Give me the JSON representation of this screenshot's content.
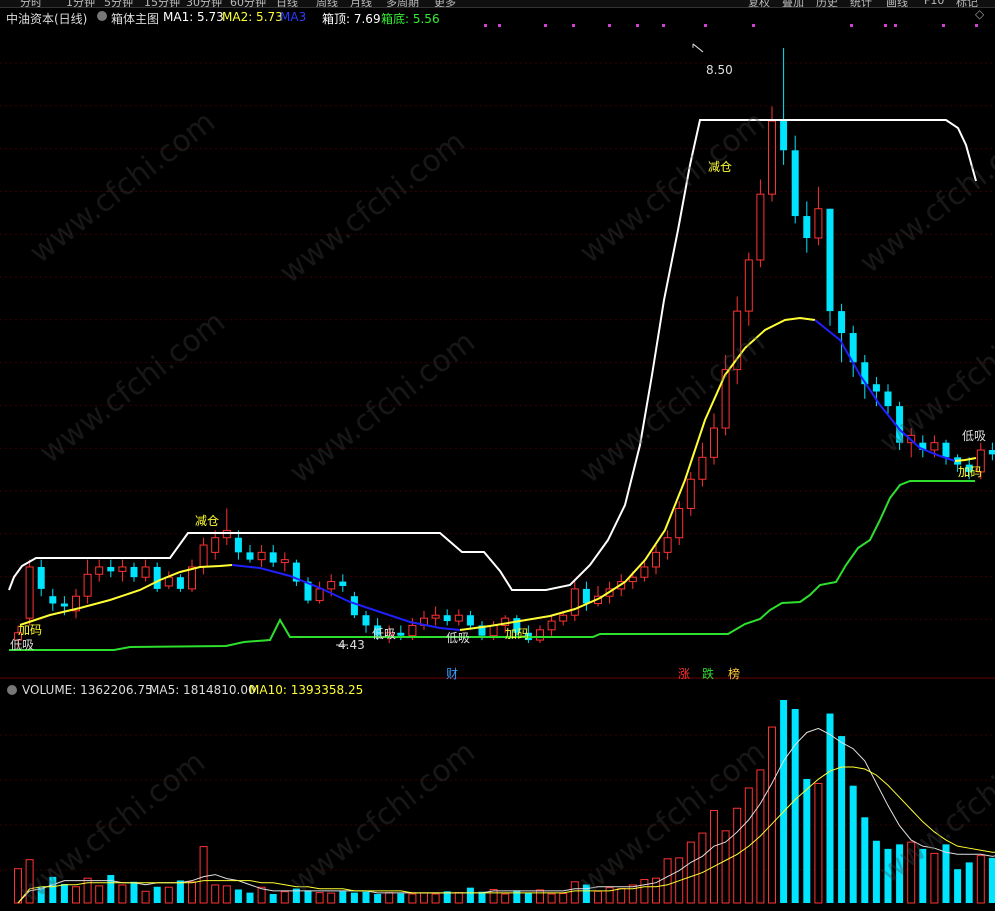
{
  "toolbar": {
    "periods": [
      "分时",
      "1分钟",
      "5分钟",
      "15分钟",
      "30分钟",
      "60分钟",
      "日线",
      "周线",
      "月线",
      "多周期",
      "更多"
    ],
    "right_buttons": [
      "复权",
      "叠加",
      "历史",
      "统计",
      "画线",
      "F10",
      "标记"
    ]
  },
  "main_panel": {
    "stock_name": "中油资本(日线)",
    "indicator_name": "箱体主图",
    "ma1_label": "MA1: 5.73",
    "ma2_label": "MA2: 5.73",
    "ma3_label": "MA3",
    "box_top_label": "箱顶: 7.69",
    "box_bottom_label": "箱底: 5.56"
  },
  "annotations": {
    "high_price": "8.50",
    "low_price": "4.43",
    "reduce1": "减仓",
    "reduce2": "减仓",
    "buy_low1": "低吸",
    "buy_low2": "低吸",
    "buy_low3": "低吸",
    "buy_low4": "低吸",
    "add1": "加码",
    "add2": "加码",
    "add3": "加码"
  },
  "event_markers": {
    "cai": "财",
    "zhang": "涨",
    "die": "跌",
    "bang": "榜"
  },
  "volume_panel": {
    "volume_label": "VOLUME: 1362206.75",
    "ma5_label": "MA5: 1814810.00",
    "ma10_label": "MA10: 1393358.25"
  },
  "watermark": "www.cfchi.com",
  "colors": {
    "up": "#ff3232",
    "down": "#00e5ff",
    "box_top": "#ffffff",
    "box_bottom": "#2ee02e",
    "ma_rise": "#ffff33",
    "ma_fall": "#2020ff",
    "cai": "#3aa0ff",
    "zhang": "#ff3030",
    "die": "#33dd33",
    "bang": "#ffcc33"
  },
  "chart_data": {
    "type": "candlestick",
    "price_range": [
      4.3,
      8.65
    ],
    "candles": [
      {
        "o": 4.45,
        "c": 4.5,
        "h": 4.55,
        "l": 4.4
      },
      {
        "o": 4.6,
        "c": 4.95,
        "h": 5.0,
        "l": 4.55
      },
      {
        "o": 4.95,
        "c": 4.8,
        "h": 5.0,
        "l": 4.75
      },
      {
        "o": 4.75,
        "c": 4.7,
        "h": 4.8,
        "l": 4.65
      },
      {
        "o": 4.7,
        "c": 4.68,
        "h": 4.75,
        "l": 4.62
      },
      {
        "o": 4.65,
        "c": 4.75,
        "h": 4.8,
        "l": 4.6
      },
      {
        "o": 4.75,
        "c": 4.9,
        "h": 5.0,
        "l": 4.7
      },
      {
        "o": 4.9,
        "c": 4.95,
        "h": 5.0,
        "l": 4.85
      },
      {
        "o": 4.95,
        "c": 4.92,
        "h": 5.0,
        "l": 4.88
      },
      {
        "o": 4.92,
        "c": 4.95,
        "h": 5.0,
        "l": 4.85
      },
      {
        "o": 4.95,
        "c": 4.88,
        "h": 4.98,
        "l": 4.85
      },
      {
        "o": 4.88,
        "c": 4.95,
        "h": 5.0,
        "l": 4.85
      },
      {
        "o": 4.95,
        "c": 4.8,
        "h": 4.98,
        "l": 4.78
      },
      {
        "o": 4.82,
        "c": 4.88,
        "h": 4.92,
        "l": 4.8
      },
      {
        "o": 4.88,
        "c": 4.8,
        "h": 4.9,
        "l": 4.78
      },
      {
        "o": 4.8,
        "c": 4.95,
        "h": 5.0,
        "l": 4.78
      },
      {
        "o": 4.95,
        "c": 5.1,
        "h": 5.15,
        "l": 4.9
      },
      {
        "o": 5.05,
        "c": 5.15,
        "h": 5.2,
        "l": 5.0
      },
      {
        "o": 5.15,
        "c": 5.2,
        "h": 5.35,
        "l": 5.1
      },
      {
        "o": 5.15,
        "c": 5.05,
        "h": 5.2,
        "l": 5.0
      },
      {
        "o": 5.05,
        "c": 5.0,
        "h": 5.1,
        "l": 4.98
      },
      {
        "o": 5.0,
        "c": 5.05,
        "h": 5.1,
        "l": 4.95
      },
      {
        "o": 5.05,
        "c": 4.98,
        "h": 5.1,
        "l": 4.95
      },
      {
        "o": 4.98,
        "c": 5.0,
        "h": 5.05,
        "l": 4.92
      },
      {
        "o": 4.98,
        "c": 4.85,
        "h": 5.0,
        "l": 4.82
      },
      {
        "o": 4.85,
        "c": 4.72,
        "h": 4.88,
        "l": 4.7
      },
      {
        "o": 4.72,
        "c": 4.8,
        "h": 4.85,
        "l": 4.7
      },
      {
        "o": 4.8,
        "c": 4.85,
        "h": 4.9,
        "l": 4.75
      },
      {
        "o": 4.85,
        "c": 4.82,
        "h": 4.9,
        "l": 4.78
      },
      {
        "o": 4.75,
        "c": 4.62,
        "h": 4.78,
        "l": 4.6
      },
      {
        "o": 4.62,
        "c": 4.55,
        "h": 4.65,
        "l": 4.5
      },
      {
        "o": 4.55,
        "c": 4.48,
        "h": 4.6,
        "l": 4.45
      },
      {
        "o": 4.48,
        "c": 4.5,
        "h": 4.55,
        "l": 4.43
      },
      {
        "o": 4.5,
        "c": 4.48,
        "h": 4.55,
        "l": 4.45
      },
      {
        "o": 4.48,
        "c": 4.55,
        "h": 4.6,
        "l": 4.45
      },
      {
        "o": 4.55,
        "c": 4.6,
        "h": 4.65,
        "l": 4.52
      },
      {
        "o": 4.6,
        "c": 4.62,
        "h": 4.68,
        "l": 4.55
      },
      {
        "o": 4.62,
        "c": 4.58,
        "h": 4.66,
        "l": 4.55
      },
      {
        "o": 4.58,
        "c": 4.62,
        "h": 4.66,
        "l": 4.55
      },
      {
        "o": 4.62,
        "c": 4.55,
        "h": 4.65,
        "l": 4.52
      },
      {
        "o": 4.55,
        "c": 4.48,
        "h": 4.58,
        "l": 4.45
      },
      {
        "o": 4.48,
        "c": 4.55,
        "h": 4.58,
        "l": 4.45
      },
      {
        "o": 4.55,
        "c": 4.6,
        "h": 4.62,
        "l": 4.5
      },
      {
        "o": 4.6,
        "c": 4.5,
        "h": 4.62,
        "l": 4.48
      },
      {
        "o": 4.5,
        "c": 4.45,
        "h": 4.55,
        "l": 4.43
      },
      {
        "o": 4.45,
        "c": 4.52,
        "h": 4.55,
        "l": 4.43
      },
      {
        "o": 4.52,
        "c": 4.58,
        "h": 4.62,
        "l": 4.48
      },
      {
        "o": 4.58,
        "c": 4.62,
        "h": 4.65,
        "l": 4.55
      },
      {
        "o": 4.62,
        "c": 4.8,
        "h": 4.85,
        "l": 4.58
      },
      {
        "o": 4.8,
        "c": 4.7,
        "h": 4.85,
        "l": 4.65
      },
      {
        "o": 4.7,
        "c": 4.75,
        "h": 4.82,
        "l": 4.68
      },
      {
        "o": 4.75,
        "c": 4.8,
        "h": 4.85,
        "l": 4.7
      },
      {
        "o": 4.8,
        "c": 4.85,
        "h": 4.9,
        "l": 4.75
      },
      {
        "o": 4.85,
        "c": 4.88,
        "h": 4.92,
        "l": 4.8
      },
      {
        "o": 4.88,
        "c": 4.95,
        "h": 5.0,
        "l": 4.85
      },
      {
        "o": 4.95,
        "c": 5.05,
        "h": 5.1,
        "l": 4.9
      },
      {
        "o": 5.05,
        "c": 5.15,
        "h": 5.2,
        "l": 5.0
      },
      {
        "o": 5.15,
        "c": 5.35,
        "h": 5.4,
        "l": 5.1
      },
      {
        "o": 5.35,
        "c": 5.55,
        "h": 5.6,
        "l": 5.3
      },
      {
        "o": 5.55,
        "c": 5.7,
        "h": 5.8,
        "l": 5.5
      },
      {
        "o": 5.7,
        "c": 5.9,
        "h": 6.0,
        "l": 5.65
      },
      {
        "o": 5.9,
        "c": 6.3,
        "h": 6.4,
        "l": 5.85
      },
      {
        "o": 6.3,
        "c": 6.7,
        "h": 6.8,
        "l": 6.2
      },
      {
        "o": 6.7,
        "c": 7.05,
        "h": 7.1,
        "l": 6.6
      },
      {
        "o": 7.05,
        "c": 7.5,
        "h": 7.6,
        "l": 7.0
      },
      {
        "o": 7.5,
        "c": 8.0,
        "h": 8.1,
        "l": 7.45
      },
      {
        "o": 8.0,
        "c": 7.8,
        "h": 8.5,
        "l": 7.7
      },
      {
        "o": 7.8,
        "c": 7.35,
        "h": 7.9,
        "l": 7.3
      },
      {
        "o": 7.35,
        "c": 7.2,
        "h": 7.45,
        "l": 7.1
      },
      {
        "o": 7.2,
        "c": 7.4,
        "h": 7.55,
        "l": 7.15
      },
      {
        "o": 7.4,
        "c": 6.7,
        "h": 7.4,
        "l": 6.6
      },
      {
        "o": 6.7,
        "c": 6.55,
        "h": 6.75,
        "l": 6.35
      },
      {
        "o": 6.55,
        "c": 6.35,
        "h": 6.6,
        "l": 6.25
      },
      {
        "o": 6.35,
        "c": 6.2,
        "h": 6.4,
        "l": 6.1
      },
      {
        "o": 6.2,
        "c": 6.15,
        "h": 6.25,
        "l": 6.05
      },
      {
        "o": 6.15,
        "c": 6.05,
        "h": 6.2,
        "l": 6.0
      },
      {
        "o": 6.05,
        "c": 5.8,
        "h": 6.08,
        "l": 5.75
      },
      {
        "o": 5.8,
        "c": 5.85,
        "h": 5.9,
        "l": 5.7
      },
      {
        "o": 5.8,
        "c": 5.75,
        "h": 5.85,
        "l": 5.7
      },
      {
        "o": 5.75,
        "c": 5.8,
        "h": 5.85,
        "l": 5.7
      },
      {
        "o": 5.8,
        "c": 5.7,
        "h": 5.82,
        "l": 5.65
      },
      {
        "o": 5.7,
        "c": 5.65,
        "h": 5.72,
        "l": 5.6
      },
      {
        "o": 5.65,
        "c": 5.6,
        "h": 5.7,
        "l": 5.55
      },
      {
        "o": 5.6,
        "c": 5.75,
        "h": 5.8,
        "l": 5.55
      },
      {
        "o": 5.75,
        "c": 5.72,
        "h": 5.8,
        "l": 5.68
      },
      {
        "o": 5.72,
        "c": 5.7,
        "h": 5.85,
        "l": 5.65
      },
      {
        "o": 5.7,
        "c": 5.65,
        "h": 5.75,
        "l": 5.6
      },
      {
        "o": 5.65,
        "c": 5.6,
        "h": 5.7,
        "l": 5.55
      },
      {
        "o": 5.6,
        "c": 5.58,
        "h": 5.62,
        "l": 5.55
      },
      {
        "o": 5.58,
        "c": 5.8,
        "h": 5.85,
        "l": 5.55
      },
      {
        "o": 5.8,
        "c": 5.72,
        "h": 5.85,
        "l": 5.6
      },
      {
        "o": 5.72,
        "c": 5.68,
        "h": 5.8,
        "l": 5.6
      },
      {
        "o": 5.68,
        "c": 6.1,
        "h": 6.25,
        "l": 5.65
      },
      {
        "o": 6.1,
        "c": 5.95,
        "h": 6.15,
        "l": 5.9
      }
    ],
    "volume_max": 4500000,
    "volume": [
      760000,
      960000,
      350000,
      580000,
      420000,
      360000,
      550000,
      380000,
      620000,
      400000,
      470000,
      260000,
      360000,
      350000,
      500000,
      470000,
      1250000,
      400000,
      380000,
      300000,
      230000,
      350000,
      200000,
      250000,
      320000,
      280000,
      230000,
      220000,
      260000,
      230000,
      250000,
      200000,
      230000,
      210000,
      200000,
      220000,
      200000,
      260000,
      230000,
      340000,
      250000,
      300000,
      200000,
      280000,
      230000,
      290000,
      200000,
      210000,
      470000,
      410000,
      260000,
      340000,
      320000,
      400000,
      520000,
      550000,
      980000,
      1000000,
      1350000,
      1550000,
      2050000,
      1600000,
      2100000,
      2550000,
      2950000,
      3900000,
      4500000,
      4300000,
      2750000,
      2650000,
      4200000,
      3700000,
      2600000,
      1900000,
      1380000,
      1200000,
      1300000,
      1350000,
      1200000,
      1100000,
      1300000,
      750000,
      900000,
      1050000,
      1000000,
      1350000,
      1050000,
      850000,
      1150000,
      1550000,
      1750000,
      1350000,
      1950000,
      2100000
    ],
    "ma5_line": [
      0.0,
      0.06,
      0.07,
      0.09,
      0.11,
      0.11,
      0.11,
      0.11,
      0.11,
      0.1,
      0.1,
      0.09,
      0.1,
      0.1,
      0.1,
      0.11,
      0.13,
      0.14,
      0.12,
      0.11,
      0.09,
      0.07,
      0.06,
      0.06,
      0.06,
      0.06,
      0.06,
      0.06,
      0.06,
      0.06,
      0.06,
      0.05,
      0.05,
      0.05,
      0.05,
      0.05,
      0.05,
      0.05,
      0.05,
      0.05,
      0.05,
      0.06,
      0.06,
      0.06,
      0.06,
      0.06,
      0.06,
      0.06,
      0.07,
      0.07,
      0.08,
      0.08,
      0.08,
      0.08,
      0.09,
      0.1,
      0.13,
      0.16,
      0.2,
      0.23,
      0.28,
      0.3,
      0.35,
      0.41,
      0.49,
      0.59,
      0.7,
      0.78,
      0.84,
      0.86,
      0.83,
      0.79,
      0.76,
      0.7,
      0.59,
      0.48,
      0.38,
      0.31,
      0.28,
      0.27,
      0.25,
      0.24,
      0.24,
      0.24,
      0.23,
      0.24,
      0.23,
      0.23,
      0.25,
      0.28,
      0.32,
      0.37,
      0.41,
      0.39
    ],
    "ma10_line": [
      0.0,
      0.07,
      0.08,
      0.08,
      0.09,
      0.09,
      0.1,
      0.1,
      0.1,
      0.1,
      0.1,
      0.1,
      0.1,
      0.1,
      0.1,
      0.1,
      0.11,
      0.11,
      0.11,
      0.11,
      0.11,
      0.1,
      0.1,
      0.09,
      0.08,
      0.08,
      0.07,
      0.07,
      0.07,
      0.06,
      0.06,
      0.06,
      0.06,
      0.06,
      0.05,
      0.05,
      0.05,
      0.05,
      0.05,
      0.05,
      0.05,
      0.05,
      0.05,
      0.05,
      0.05,
      0.05,
      0.05,
      0.05,
      0.06,
      0.06,
      0.06,
      0.06,
      0.07,
      0.07,
      0.08,
      0.08,
      0.09,
      0.11,
      0.13,
      0.15,
      0.18,
      0.21,
      0.24,
      0.28,
      0.33,
      0.39,
      0.45,
      0.51,
      0.56,
      0.61,
      0.65,
      0.67,
      0.67,
      0.66,
      0.63,
      0.58,
      0.52,
      0.46,
      0.4,
      0.35,
      0.31,
      0.28,
      0.27,
      0.26,
      0.25,
      0.25,
      0.24,
      0.24,
      0.24,
      0.26,
      0.28,
      0.3,
      0.32,
      0.33
    ]
  }
}
